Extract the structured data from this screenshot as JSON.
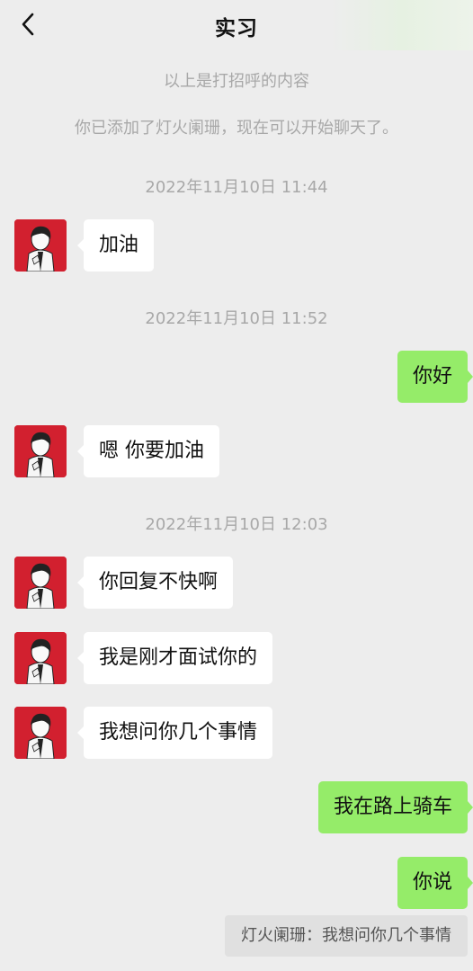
{
  "header": {
    "title": "实习"
  },
  "system_messages": [
    "以上是打招呼的内容",
    "你已添加了灯火阑珊，现在可以开始聊天了。"
  ],
  "timestamps": [
    "2022年11月10日 11:44",
    "2022年11月10日 11:52",
    "2022年11月10日 12:03"
  ],
  "messages": [
    {
      "side": "left",
      "text": "加油"
    },
    {
      "side": "right",
      "text": "你好"
    },
    {
      "side": "left",
      "text": "嗯 你要加油"
    },
    {
      "side": "left",
      "text": "你回复不快啊"
    },
    {
      "side": "left",
      "text": "我是刚才面试你的"
    },
    {
      "side": "left",
      "text": "我想问你几个事情"
    },
    {
      "side": "right",
      "text": "我在路上骑车"
    },
    {
      "side": "right",
      "text": "你说"
    }
  ],
  "quote": {
    "text": "灯火阑珊：我想问你几个事情"
  },
  "colors": {
    "background": "#ededed",
    "self_bubble": "#95ec69",
    "other_bubble": "#ffffff",
    "avatar_bg": "#d2202f"
  },
  "icons": {
    "back": "chevron-left-icon",
    "avatar": "anime-portrait-avatar"
  }
}
